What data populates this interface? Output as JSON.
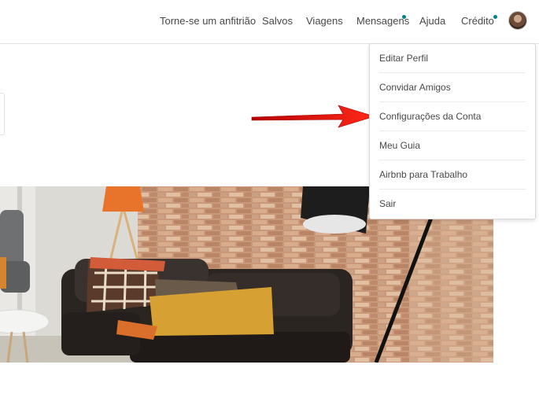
{
  "nav": {
    "items": [
      {
        "label": "Torne-se um anfitrião"
      },
      {
        "label": "Salvos"
      },
      {
        "label": "Viagens"
      },
      {
        "label": "Mensagens"
      },
      {
        "label": "Ajuda"
      },
      {
        "label": "Crédito"
      }
    ],
    "notification_color": "#008489"
  },
  "dropdown": {
    "items": [
      {
        "label": "Editar Perfil"
      },
      {
        "label": "Convidar Amigos"
      },
      {
        "label": "Configurações da Conta"
      },
      {
        "label": "Meu Guia"
      },
      {
        "label": "Airbnb para Trabalho"
      },
      {
        "label": "Sair"
      }
    ]
  },
  "annotation": {
    "arrow_color": "#e01010",
    "icon": "red-arrow-pointer"
  }
}
